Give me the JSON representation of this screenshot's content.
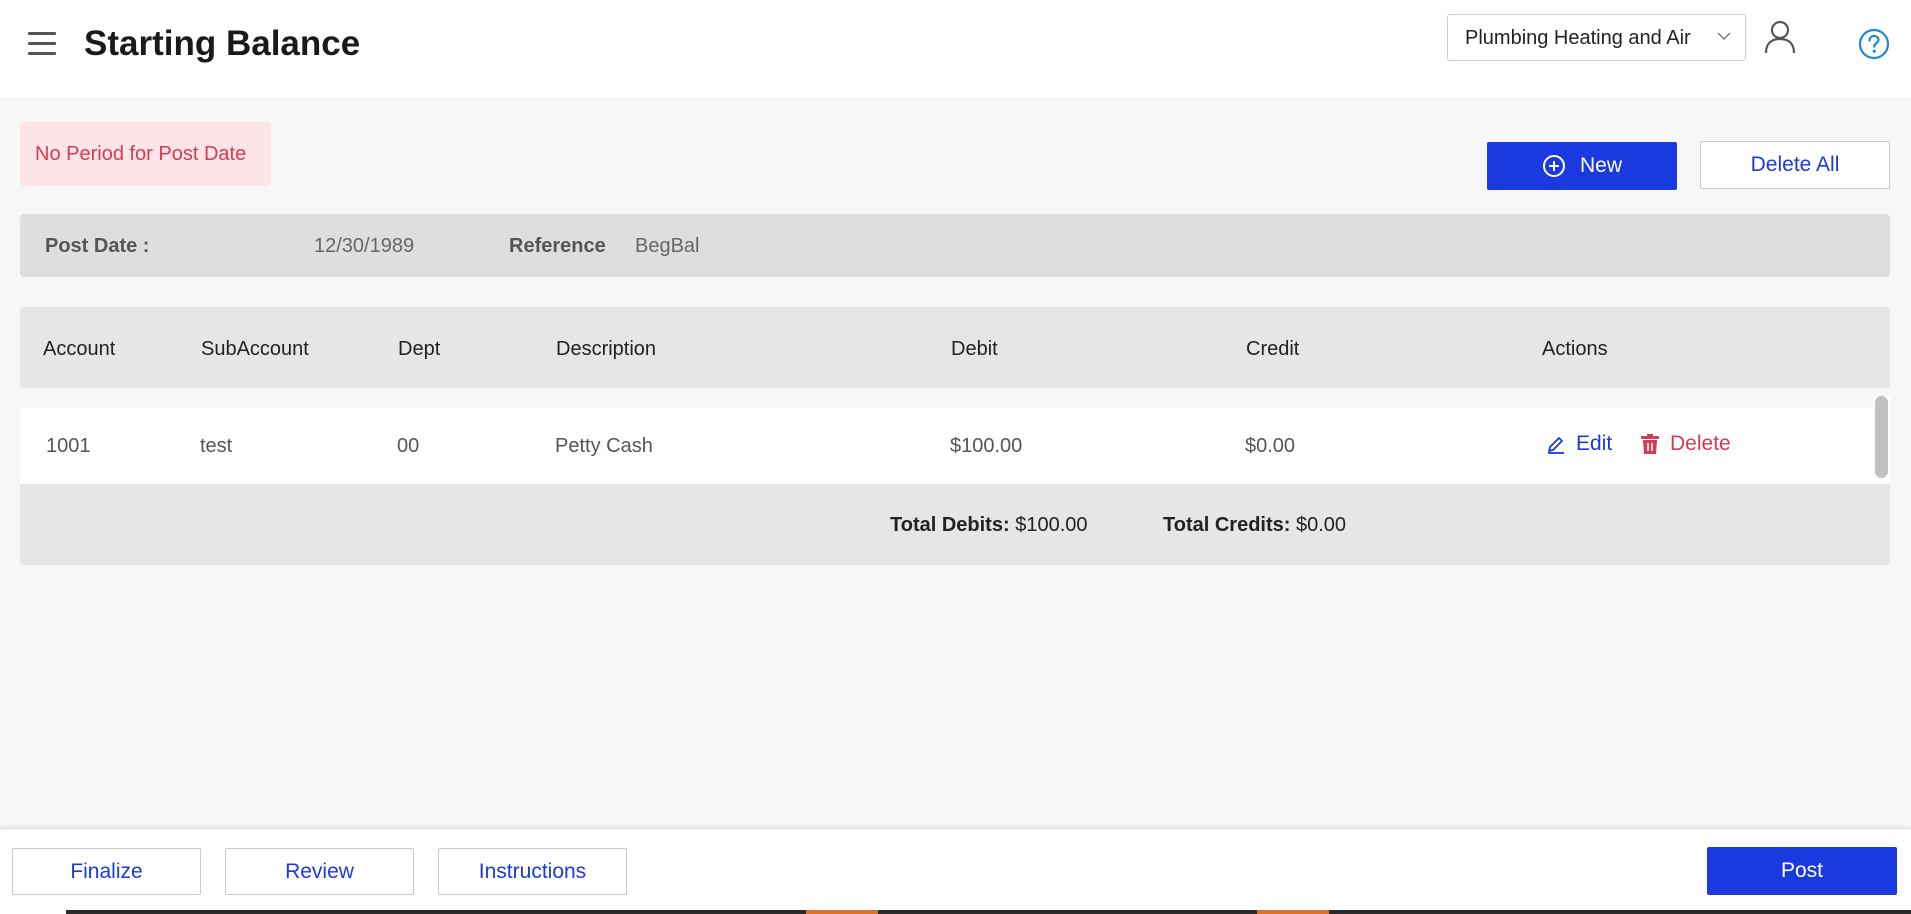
{
  "header": {
    "title": "Starting Balance",
    "company_selected": "Plumbing Heating and Air"
  },
  "alert": {
    "text": "No Period for Post Date"
  },
  "actions": {
    "new_label": "New",
    "delete_all_label": "Delete All"
  },
  "entry": {
    "post_date_label": "Post Date :",
    "post_date_value": "12/30/1989",
    "reference_label": "Reference",
    "reference_value": "BegBal"
  },
  "table": {
    "columns": [
      "Account",
      "SubAccount",
      "Dept",
      "Description",
      "Debit",
      "Credit",
      "Actions"
    ],
    "rows": [
      {
        "account": "1001",
        "subaccount": "test",
        "dept": "00",
        "description": "Petty Cash",
        "debit": "$100.00",
        "credit": "$0.00"
      }
    ],
    "row_actions": {
      "edit": "Edit",
      "delete": "Delete"
    },
    "totals": {
      "debits_label": "Total Debits:",
      "debits_value": "$100.00",
      "credits_label": "Total Credits:",
      "credits_value": "$0.00"
    }
  },
  "footer": {
    "finalize": "Finalize",
    "review": "Review",
    "instructions": "Instructions",
    "post": "Post"
  },
  "colors": {
    "primary": "#1a3ae0",
    "danger": "#d43c54",
    "alert_bg": "#fde4e7",
    "help": "#1e8ad6"
  }
}
